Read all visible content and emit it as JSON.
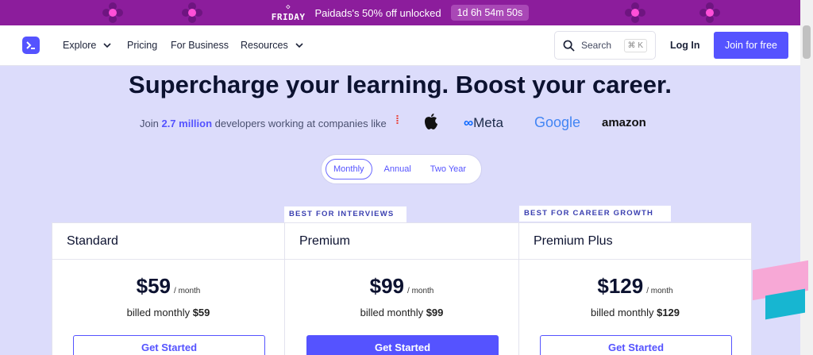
{
  "promo": {
    "brand_line": "FRIDAY",
    "message": "Paidads's 50% off unlocked",
    "timer": "1d 6h 54m 50s"
  },
  "nav": {
    "explore": "Explore",
    "pricing": "Pricing",
    "business": "For Business",
    "resources": "Resources",
    "search_label": "Search",
    "search_shortcut": "⌘ K",
    "login": "Log In",
    "join": "Join for free"
  },
  "hero": {
    "title": "Supercharge your learning. Boost your career.",
    "join_prefix": "Join ",
    "join_count": "2.7 million",
    "join_suffix": " developers working at companies like",
    "companies": [
      "Meta",
      "Google",
      "amazon"
    ]
  },
  "billing": {
    "options": [
      "Monthly",
      "Annual",
      "Two Year"
    ],
    "selected": "Monthly"
  },
  "plans": [
    {
      "name": "Standard",
      "price": "$59",
      "per": "/ month",
      "billed_prefix": "billed monthly ",
      "billed_amount": "$59",
      "cta": "Get Started",
      "tag": ""
    },
    {
      "name": "Premium",
      "price": "$99",
      "per": "/ month",
      "billed_prefix": "billed monthly ",
      "billed_amount": "$99",
      "cta": "Get Started",
      "tag": "BEST FOR INTERVIEWS"
    },
    {
      "name": "Premium Plus",
      "price": "$129",
      "per": "/ month",
      "billed_prefix": "billed monthly ",
      "billed_amount": "$129",
      "cta": "Get Started",
      "tag": "BEST FOR CAREER GROWTH"
    }
  ],
  "colors": {
    "accent": "#5553ff",
    "promo_bg": "#8c1d9c",
    "page_bg": "#dcdcfb"
  }
}
